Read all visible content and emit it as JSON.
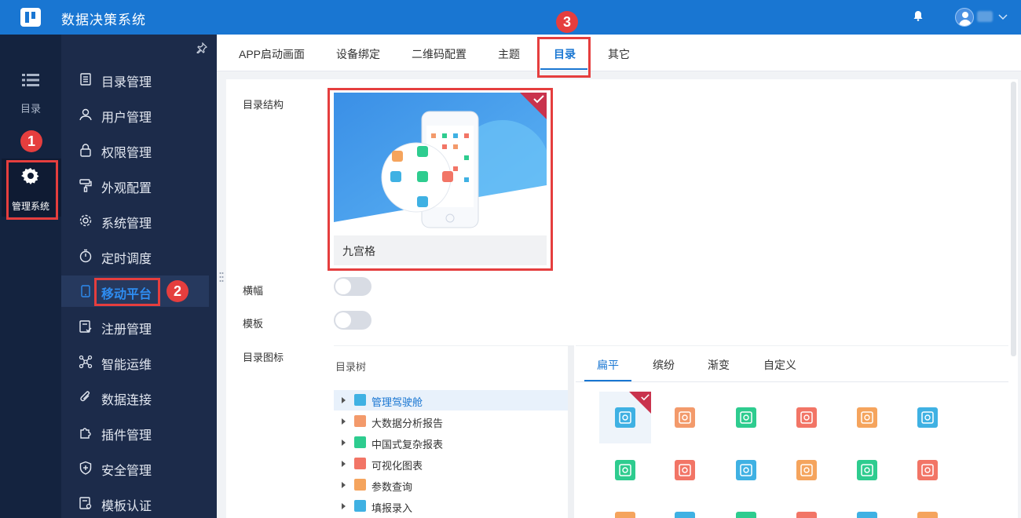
{
  "app": {
    "title": "数据决策系统"
  },
  "rail": {
    "catalog_label": "目录",
    "admin_label": "管理系统"
  },
  "menu": {
    "items": [
      {
        "label": "目录管理",
        "icon": "list-icon"
      },
      {
        "label": "用户管理",
        "icon": "user-icon"
      },
      {
        "label": "权限管理",
        "icon": "lock-icon"
      },
      {
        "label": "外观配置",
        "icon": "paint-roller-icon"
      },
      {
        "label": "系统管理",
        "icon": "gear-icon"
      },
      {
        "label": "定时调度",
        "icon": "stopwatch-icon"
      },
      {
        "label": "移动平台",
        "icon": "tablet-icon"
      },
      {
        "label": "注册管理",
        "icon": "register-icon"
      },
      {
        "label": "智能运维",
        "icon": "network-icon"
      },
      {
        "label": "数据连接",
        "icon": "paperclip-icon"
      },
      {
        "label": "插件管理",
        "icon": "puzzle-icon"
      },
      {
        "label": "安全管理",
        "icon": "shield-icon"
      },
      {
        "label": "模板认证",
        "icon": "certificate-icon"
      }
    ],
    "active_index": 6
  },
  "tabs": [
    "APP启动画面",
    "设备绑定",
    "二维码配置",
    "主题",
    "目录",
    "其它"
  ],
  "active_tab": "目录",
  "form": {
    "structure_label": "目录结构",
    "layout_name": "九宫格",
    "banner_label": "横幅",
    "banner_on": false,
    "template_label": "模板",
    "template_on": false,
    "icon_label": "目录图标"
  },
  "tree": {
    "title": "目录树",
    "items": [
      {
        "label": "管理驾驶舱",
        "color": "#3fb1e3"
      },
      {
        "label": "大数据分析报告",
        "color": "#f39a6b"
      },
      {
        "label": "中国式复杂报表",
        "color": "#2ecc8f"
      },
      {
        "label": "可视化图表",
        "color": "#f27566"
      },
      {
        "label": "参数查询",
        "color": "#f5a45d"
      },
      {
        "label": "填报录入",
        "color": "#3fb1e3"
      }
    ]
  },
  "icon_tabs": [
    "扁平",
    "缤纷",
    "渐变",
    "自定义"
  ],
  "icon_grid": [
    {
      "name": "house-icon",
      "color": "#3fb1e3"
    },
    {
      "name": "image-frame-icon",
      "color": "#f39a6b"
    },
    {
      "name": "search-doc-icon",
      "color": "#2ecc8f"
    },
    {
      "name": "document-icon",
      "color": "#f27566"
    },
    {
      "name": "pie-chart-icon",
      "color": "#f5a45d"
    },
    {
      "name": "bar-chart-icon",
      "color": "#3fb1e3"
    },
    {
      "name": "yuan-doc-icon",
      "color": "#2ecc8f"
    },
    {
      "name": "cycle-icon",
      "color": "#f27566"
    },
    {
      "name": "scale-icon",
      "color": "#3fb1e3"
    },
    {
      "name": "briefcase-icon",
      "color": "#f5a45d"
    },
    {
      "name": "user-settings-icon",
      "color": "#2ecc8f"
    },
    {
      "name": "user-network-icon",
      "color": "#f27566"
    }
  ],
  "annotations": [
    "1",
    "2",
    "3"
  ],
  "colors": {
    "primary": "#1976d2",
    "sidebar": "#1c2b4a",
    "rail": "#14233f",
    "annotation": "#e53e3e"
  }
}
